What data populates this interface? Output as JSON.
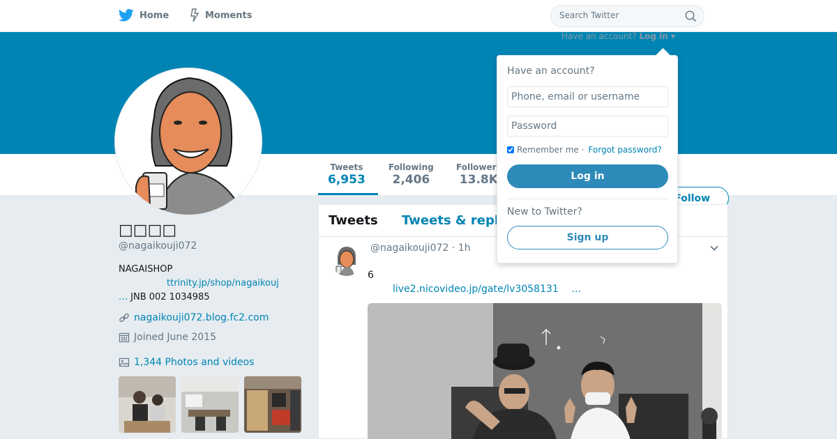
{
  "nav": {
    "home_label": "Home",
    "moments_label": "Moments",
    "search_placeholder": "Search Twitter",
    "login_prompt_text": "Have an account?",
    "login_prompt_link": "Log in ▾"
  },
  "profile": {
    "display_name": "□□□□",
    "handle": "@nagaikouji072",
    "bio_line1": "NAGAISHOP",
    "bio_link": "ttrinity.jp/shop/nagaikouj",
    "bio_line3_prefix": "…",
    "bio_line3": " JNB 002 1034985",
    "url": "nagaikouji072.blog.fc2.com",
    "joined": "Joined June 2015",
    "photos_label": "1,344 Photos and videos"
  },
  "stats": [
    {
      "label": "Tweets",
      "value": "6,953"
    },
    {
      "label": "Following",
      "value": "2,406"
    },
    {
      "label": "Followers",
      "value": "13.8K"
    }
  ],
  "follow_button": "Follow",
  "timeline": {
    "tabs": [
      "Tweets",
      "Tweets & replies"
    ],
    "tweet": {
      "handle": "@nagaikouji072",
      "time": " · 1h",
      "text": "6",
      "link": "live2.nicovideo.jp/gate/lv3058131",
      "link_ellipsis": "…"
    }
  },
  "login_dropdown": {
    "heading": "Have an account?",
    "username_placeholder": "Phone, email or username",
    "password_placeholder": "Password",
    "remember_label": "Remember me ·",
    "forgot_label": "Forgot password?",
    "login_button": "Log in",
    "new_heading": "New to Twitter?",
    "signup_button": "Sign up"
  },
  "colors": {
    "brand": "#0084b4",
    "banner": "#0084b4",
    "button_blue": "#2e8ab8",
    "background": "#e6ecf0"
  },
  "icons": [
    "twitter-bird-icon",
    "moments-bolt-icon",
    "search-icon",
    "link-icon",
    "calendar-icon",
    "photo-icon",
    "chevron-down-icon"
  ]
}
